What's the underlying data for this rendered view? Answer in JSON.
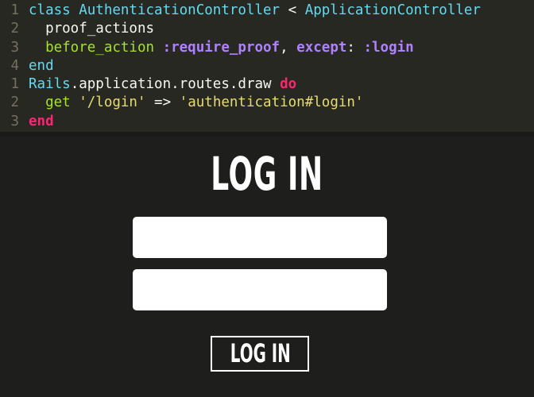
{
  "editor": {
    "lines": [
      {
        "num": "1",
        "tokens": [
          {
            "text": "class ",
            "cls": "kw-plain"
          },
          {
            "text": "AuthenticationController",
            "cls": "kw-plain"
          },
          {
            "text": " < ",
            "cls": "fg"
          },
          {
            "text": "ApplicationController",
            "cls": "kw-plain"
          }
        ]
      },
      {
        "num": "2",
        "tokens": [
          {
            "text": "  proof_actions",
            "cls": "fg"
          }
        ]
      },
      {
        "num": "3",
        "tokens": [
          {
            "text": "  before_action ",
            "cls": "green"
          },
          {
            "text": ":require_proof",
            "cls": "purple"
          },
          {
            "text": ", ",
            "cls": "fg"
          },
          {
            "text": "except",
            "cls": "purple"
          },
          {
            "text": ": ",
            "cls": "fg"
          },
          {
            "text": ":login",
            "cls": "purple"
          }
        ]
      },
      {
        "num": "4",
        "tokens": [
          {
            "text": "end",
            "cls": "kw-plain"
          }
        ]
      },
      {
        "num": "1",
        "tokens": [
          {
            "text": "Rails",
            "cls": "kw-plain"
          },
          {
            "text": ".application.routes.draw ",
            "cls": "fg"
          },
          {
            "text": "do",
            "cls": "kw-pink"
          }
        ]
      },
      {
        "num": "2",
        "tokens": [
          {
            "text": "  get ",
            "cls": "green"
          },
          {
            "text": "'/login'",
            "cls": "str"
          },
          {
            "text": " => ",
            "cls": "fg"
          },
          {
            "text": "'authentication#login'",
            "cls": "str"
          }
        ]
      },
      {
        "num": "3",
        "tokens": [
          {
            "text": "end",
            "cls": "kw-pink"
          }
        ]
      }
    ]
  },
  "login": {
    "title": "LOG IN",
    "username_value": "",
    "password_value": "",
    "button_label": "LOG IN"
  },
  "colors": {
    "editor_bg": "#272822",
    "page_bg": "#1e1f1c",
    "keyword_blue": "#66d9ef",
    "keyword_pink": "#f92672",
    "method_green": "#a6e22e",
    "symbol_purple": "#ae81ff",
    "string_yellow": "#e6db74",
    "line_number": "#75715e"
  }
}
